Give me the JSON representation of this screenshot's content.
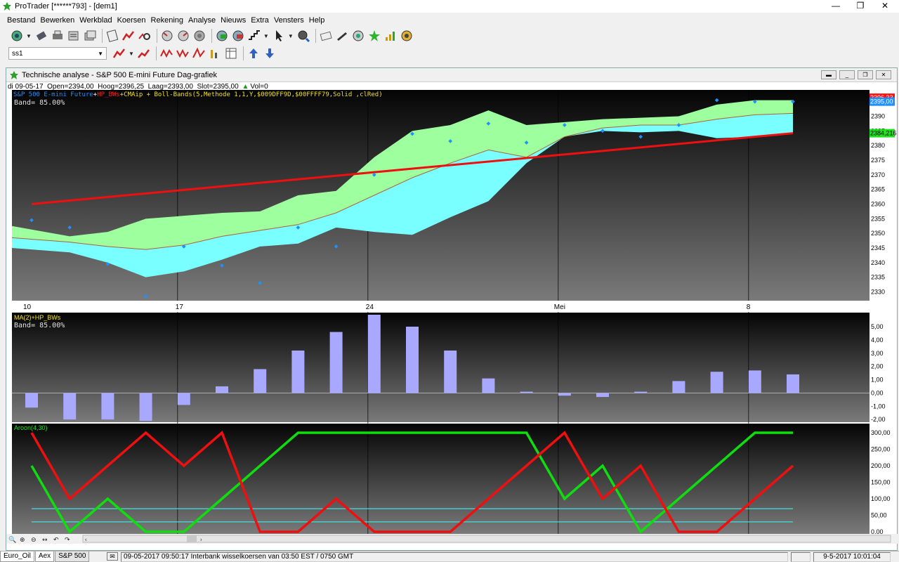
{
  "window": {
    "title": "ProTrader [******793] - [dem1]",
    "buttons": [
      "—",
      "❐",
      "✕"
    ]
  },
  "menu": [
    "Bestand",
    "Bewerken",
    "Werkblad",
    "Koersen",
    "Rekening",
    "Analyse",
    "Nieuws",
    "Extra",
    "Vensters",
    "Help"
  ],
  "toolbar2": {
    "combo_value": "ss1"
  },
  "document": {
    "title": "Technische analyse -    S&P 500 E-mini Future Dag-grafiek",
    "info": {
      "date": "di 09-05-17",
      "open": "Open=2394,00",
      "high": "Hoog=2396,25",
      "low": "Laag=2393,00",
      "close": "Slot=2395,00",
      "vol": "Vol=0"
    }
  },
  "panels": {
    "price": {
      "legend_parts": [
        {
          "text": "S&P 500 E-mini Future",
          "color": "#1e8fff"
        },
        {
          "text": "+",
          "color": "#ffffff"
        },
        {
          "text": "HP_BWs",
          "color": "#ff2020"
        },
        {
          "text": "+CMAip + Boll-Bands(5,Methode 1,1,Y,$009DFF9D,$00FFFF79,Solid     ,clRed)",
          "color": "#f0e020"
        }
      ],
      "band_label": "Band= 85.00%",
      "price_tags": [
        {
          "text": "2396,33",
          "bg": "#ff1010",
          "fg": "#ffffff"
        },
        {
          "text": "2395,00",
          "bg": "#1e90ff",
          "fg": "#ffffff"
        },
        {
          "text": "2384,216",
          "bg": "#20e020",
          "fg": "#000000"
        }
      ],
      "yticks": [
        "2390",
        "2385",
        "2380",
        "2375",
        "2370",
        "2365",
        "2360",
        "2355",
        "2350",
        "2345",
        "2340",
        "2335",
        "2330"
      ],
      "xlabels": [
        "10",
        "17",
        "24",
        "Mei",
        "8"
      ]
    },
    "ma": {
      "legend": "MA(2)+HP_BWs",
      "band_label": "Band= 85.00%",
      "yticks": [
        "5,00",
        "4,00",
        "3,00",
        "2,00",
        "1,00",
        "0,00",
        "-1,00",
        "-2,00"
      ]
    },
    "aroon": {
      "legend": "Aroon(4,30)",
      "yticks": [
        "300,00",
        "250,00",
        "200,00",
        "150,00",
        "100,00",
        "50,00",
        "0,00"
      ]
    }
  },
  "chart_data": [
    {
      "type": "line",
      "panel": "price",
      "ylim": [
        2327,
        2399
      ],
      "x": [
        0,
        1,
        2,
        3,
        4,
        5,
        6,
        7,
        8,
        9,
        10,
        11,
        12,
        13,
        14,
        15,
        16,
        17,
        18,
        19,
        20
      ],
      "close_points": [
        2354.5,
        2352,
        2339.5,
        2328.5,
        2345.5,
        2339,
        2333,
        2352,
        2345.5,
        2370,
        2384,
        2381.5,
        2387.5,
        2381,
        2387,
        2385,
        2383,
        2387,
        2395.5,
        2395,
        2395
      ],
      "upper_band": [
        2352.5,
        2349,
        2350.5,
        2355,
        2356,
        2357,
        2357.5,
        2363,
        2364.5,
        2376,
        2385,
        2387,
        2392,
        2387,
        2388,
        2389,
        2389.5,
        2390,
        2394,
        2395.5,
        2395.5
      ],
      "middle_band": [
        2348.5,
        2347,
        2345.5,
        2344.5,
        2346,
        2349,
        2351,
        2353,
        2357,
        2363,
        2369,
        2374,
        2378.5,
        2376,
        2383,
        2386,
        2387,
        2387,
        2389,
        2390.5,
        2391
      ],
      "lower_band": [
        2345,
        2343.5,
        2340,
        2335,
        2337,
        2341,
        2345.5,
        2346.5,
        2352,
        2350.5,
        2349.5,
        2355.5,
        2361,
        2374,
        2383,
        2385,
        2384.5,
        2385,
        2382.5,
        2383,
        2384
      ],
      "trend_line": {
        "start": 2360,
        "end": 2384.2
      },
      "xlabels": [
        {
          "i": 0,
          "label": "10"
        },
        {
          "i": 4,
          "label": "17"
        },
        {
          "i": 9,
          "label": "24"
        },
        {
          "i": 14,
          "label": "Mei"
        },
        {
          "i": 19,
          "label": "8"
        }
      ]
    },
    {
      "type": "bar",
      "panel": "ma",
      "ylim": [
        -2.2,
        5.9
      ],
      "values": [
        -1.1,
        -2.0,
        -2.0,
        -2.1,
        -0.9,
        0.5,
        1.8,
        3.2,
        4.6,
        5.9,
        5.0,
        3.2,
        1.1,
        0.1,
        -0.2,
        -0.3,
        0.1,
        0.9,
        1.6,
        1.7,
        1.4
      ]
    },
    {
      "type": "line",
      "panel": "aroon",
      "ylim": [
        0,
        300
      ],
      "series": [
        {
          "values": [
            200,
            0,
            100,
            0,
            0,
            100,
            200,
            300,
            300,
            300,
            300,
            300,
            300,
            300,
            100,
            200,
            0,
            100,
            200,
            300,
            300
          ],
          "color": "#10dd10"
        },
        {
          "values": [
            300,
            100,
            200,
            300,
            200,
            300,
            0,
            0,
            100,
            0,
            0,
            0,
            100,
            200,
            300,
            100,
            200,
            0,
            0,
            100,
            200
          ],
          "color": "#ee1010"
        }
      ],
      "levels": [
        70,
        30
      ]
    }
  ],
  "chart_nav": {
    "zoom_icons": [
      "🔍",
      "⊕",
      "⊖",
      "↔",
      "↶",
      "↷"
    ]
  },
  "statusbar": {
    "tabs": [
      "Euro_Oil",
      "Aex",
      "S&P 500"
    ],
    "message": "09-05-2017 09:50:17 Interbank wisselkoersen van 03:50 EST / 0750 GMT",
    "datetime": "9-5-2017 10:01:04"
  }
}
